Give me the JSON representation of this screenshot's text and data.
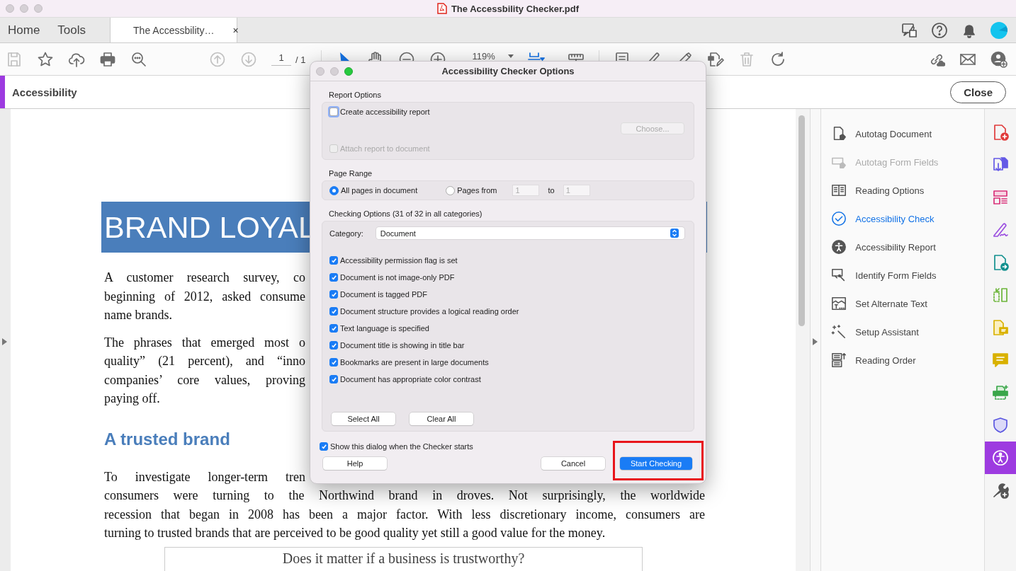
{
  "window": {
    "title": "The Accessbility Checker.pdf"
  },
  "tabs": [
    {
      "label": "Home",
      "selected": false
    },
    {
      "label": "Tools",
      "selected": false
    },
    {
      "label": "The Accessbility…",
      "selected": true,
      "close": "×"
    }
  ],
  "toolbar": {
    "groups": [
      {
        "items": [
          {
            "kind": "save",
            "disabled": true,
            "selected": false
          },
          {
            "kind": "star",
            "disabled": false,
            "selected": false
          },
          {
            "kind": "upload",
            "disabled": false,
            "selected": false
          },
          {
            "kind": "print",
            "disabled": false,
            "selected": false
          },
          {
            "kind": "search",
            "disabled": false,
            "selected": false
          }
        ]
      },
      {
        "items": [
          {
            "kind": "up",
            "disabled": true,
            "selected": false
          },
          {
            "kind": "down",
            "disabled": true,
            "selected": false
          },
          {
            "kind": "page",
            "value": "1",
            "total": "/ 1"
          }
        ]
      },
      {
        "items": [
          {
            "kind": "pointer",
            "disabled": false,
            "selected": true
          },
          {
            "kind": "hand",
            "disabled": false,
            "selected": false
          },
          {
            "kind": "zoomout",
            "disabled": false,
            "selected": false
          },
          {
            "kind": "zoomin",
            "disabled": false,
            "selected": false
          },
          {
            "kind": "zoom",
            "value": "119%"
          }
        ]
      },
      {
        "items": [
          {
            "kind": "fit",
            "disabled": false,
            "selected": true
          },
          {
            "kind": "ruler",
            "disabled": false,
            "selected": false
          }
        ]
      },
      {
        "items": [
          {
            "kind": "comment",
            "disabled": false,
            "selected": false
          },
          {
            "kind": "pen",
            "disabled": false,
            "selected": false
          },
          {
            "kind": "highlighter",
            "disabled": false,
            "selected": false
          },
          {
            "kind": "edit",
            "disabled": false,
            "selected": false
          },
          {
            "kind": "trash",
            "disabled": true,
            "selected": false
          },
          {
            "kind": "rotate",
            "disabled": false,
            "selected": false
          }
        ]
      },
      {
        "items": [
          {
            "kind": "link",
            "disabled": false,
            "selected": false
          },
          {
            "kind": "mail",
            "disabled": false,
            "selected": false
          },
          {
            "kind": "adduser",
            "disabled": false,
            "selected": false
          }
        ]
      }
    ]
  },
  "tool_bar": {
    "title": "Accessibility",
    "close": "Close"
  },
  "document": {
    "title": "BRAND LOYAL",
    "paragraphs_before": [
      {
        "lines": [
          {
            "text": "A customer research survey, co",
            "kind": "covered"
          },
          {
            "text": "beginning of 2012, asked consume",
            "kind": "covered"
          },
          {
            "text": "name brands.",
            "kind": "end"
          }
        ]
      },
      {
        "lines": [
          {
            "text": "The phrases that emerged most o",
            "kind": "covered"
          },
          {
            "text": "quality” (21 percent), and “inno",
            "kind": "covered"
          },
          {
            "text": "companies’ core values, proving",
            "kind": "covered"
          },
          {
            "text": "paying off.",
            "kind": "end"
          }
        ]
      }
    ],
    "heading": "A trusted brand",
    "paragraphs_after": [
      {
        "lines": [
          {
            "text": "To investigate longer-term tren",
            "kind": "covered"
          },
          {
            "text": "consumers were turning to the Northwind brand in droves. Not surprisingly, the worldwide",
            "kind": "full"
          },
          {
            "text": "recession that began in 2008 has been a major factor. With less discretionary income, consumers are",
            "kind": "full"
          },
          {
            "text": "turning to trusted brands that are perceived to be good quality yet still a good value for the money.",
            "kind": "end"
          }
        ]
      }
    ],
    "callout": "Does it matter if a business is trustworthy?"
  },
  "panel": {
    "items": [
      {
        "label": "Autotag Document",
        "kind": "autotag",
        "selected": false,
        "disabled": false
      },
      {
        "label": "Autotag Form Fields",
        "kind": "formfields",
        "selected": false,
        "disabled": true
      },
      {
        "label": "Reading Options",
        "kind": "reading",
        "selected": false,
        "disabled": false
      },
      {
        "label": "Accessibility Check",
        "kind": "check",
        "selected": true,
        "disabled": false
      },
      {
        "label": "Accessibility Report",
        "kind": "report",
        "selected": false,
        "disabled": false
      },
      {
        "label": "Identify Form Fields",
        "kind": "identify",
        "selected": false,
        "disabled": false
      },
      {
        "label": "Set Alternate Text",
        "kind": "alttext",
        "selected": false,
        "disabled": false
      },
      {
        "label": "Setup Assistant",
        "kind": "setup",
        "selected": false,
        "disabled": false
      },
      {
        "label": "Reading Order",
        "kind": "order",
        "selected": false,
        "disabled": false
      }
    ]
  },
  "tool_strip": [
    {
      "kind": "createpdf",
      "selected": false
    },
    {
      "kind": "combine",
      "selected": false
    },
    {
      "kind": "organize",
      "selected": false
    },
    {
      "kind": "sign",
      "selected": false
    },
    {
      "kind": "export",
      "selected": false
    },
    {
      "kind": "compress",
      "selected": false
    },
    {
      "kind": "notes",
      "selected": false
    },
    {
      "kind": "comment",
      "selected": false
    },
    {
      "kind": "print",
      "selected": false
    },
    {
      "kind": "protect",
      "selected": false
    },
    {
      "kind": "accessibility",
      "selected": true
    },
    {
      "kind": "tools",
      "selected": false
    }
  ],
  "dialog": {
    "title": "Accessibility Checker Options",
    "report_options": {
      "label": "Report Options",
      "create_report": {
        "label": "Create accessibility report",
        "checked": false,
        "focused": true
      },
      "choose_button": {
        "label": "Choose...",
        "disabled": true
      },
      "attach": {
        "label": "Attach report to document",
        "checked": false,
        "disabled": true
      }
    },
    "page_range": {
      "label": "Page Range",
      "options": [
        {
          "label": "All pages in document",
          "selected": true
        },
        {
          "label": "Pages from",
          "selected": false
        }
      ],
      "from": "1",
      "to_label": "to",
      "to": "1"
    },
    "checking_options": {
      "label": "Checking Options (31 of 32 in all categories)",
      "category_label": "Category:",
      "category": "Document",
      "checks": [
        {
          "label": "Accessibility permission flag is set",
          "checked": true
        },
        {
          "label": "Document is not image-only PDF",
          "checked": true
        },
        {
          "label": "Document is tagged PDF",
          "checked": true
        },
        {
          "label": "Document structure provides a logical reading order",
          "checked": true
        },
        {
          "label": "Text language is specified",
          "checked": true
        },
        {
          "label": "Document title is showing in title bar",
          "checked": true
        },
        {
          "label": "Bookmarks are present in large documents",
          "checked": true
        },
        {
          "label": "Document has appropriate color contrast",
          "checked": true
        }
      ],
      "buttons": [
        "Select All",
        "Clear All"
      ]
    },
    "show_dialog": {
      "label": "Show this dialog when the Checker starts",
      "checked": true
    },
    "buttons": [
      {
        "label": "Help",
        "kind": "normal"
      },
      {
        "label": "Cancel",
        "kind": "normal"
      },
      {
        "label": "Start Checking",
        "kind": "default"
      }
    ],
    "annotation_frame": true
  }
}
